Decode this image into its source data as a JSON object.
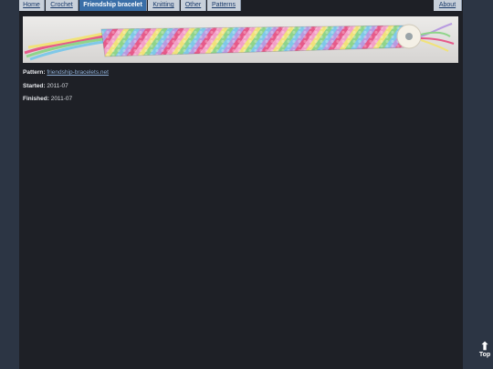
{
  "nav": {
    "items": [
      {
        "label": "Home",
        "active": false
      },
      {
        "label": "Crochet",
        "active": false
      },
      {
        "label": "Friendship bracelet",
        "active": true
      },
      {
        "label": "Knitting",
        "active": false
      },
      {
        "label": "Other",
        "active": false
      },
      {
        "label": "Patterns",
        "active": false
      }
    ],
    "about": "About"
  },
  "details": {
    "pattern_label": "Pattern:",
    "pattern_link": "friendship-bracelets.net",
    "started_label": "Started:",
    "started_value": "2011-07",
    "finished_label": "Finished:",
    "finished_value": "2011-07"
  },
  "top_button": {
    "label": "Top",
    "icon": "arrow-up-icon"
  },
  "colors": {
    "page_bg": "#1e2026",
    "side_bg": "#2c3544",
    "tab_bg": "#c8d0da",
    "tab_active_bg": "#3a6fa8",
    "link": "#8fb0d8"
  }
}
